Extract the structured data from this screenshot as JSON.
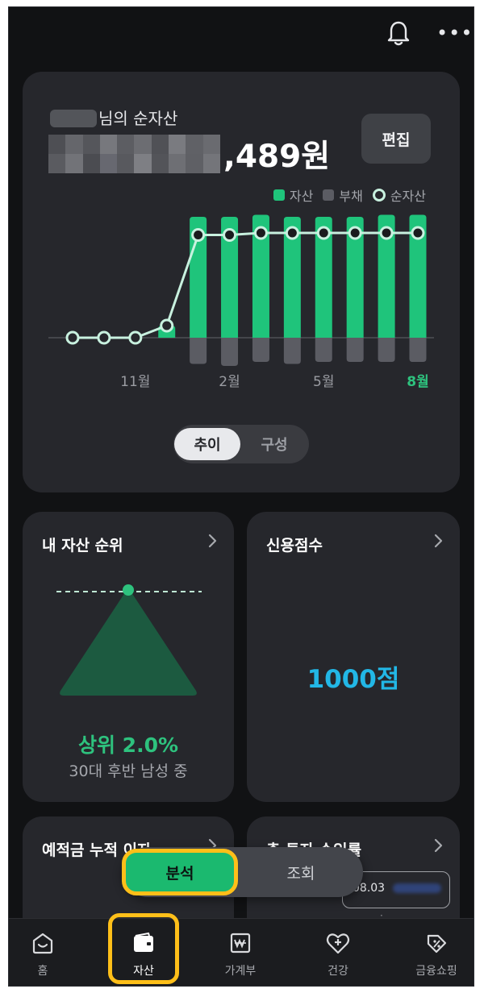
{
  "header": {
    "bell_icon": "bell-icon",
    "more_icon": "more-icon",
    "more_glyph": "•••"
  },
  "net_worth": {
    "owner_suffix": "님의 순자산",
    "amount_visible": ",489원",
    "edit_label": "편집"
  },
  "colors": {
    "asset": "#1fc47b",
    "debt": "#5b5c63",
    "net": "#c8f1df",
    "accent": "#2ec27e",
    "highlight": "#ffbf19",
    "credit": "#22b7e6"
  },
  "chart_data": {
    "type": "bar",
    "legend": [
      "자산",
      "부채",
      "순자산"
    ],
    "x_tick_labels": [
      "11월",
      "2월",
      "5월",
      "8월"
    ],
    "highlighted_tick": "8월",
    "series": [
      {
        "name": "자산",
        "values": [
          0,
          0,
          0,
          0.3,
          3.0,
          3.0,
          3.05,
          3.0,
          3.0,
          3.0,
          3.05,
          3.05
        ]
      },
      {
        "name": "부채",
        "values": [
          0,
          0,
          0,
          0,
          -0.65,
          -0.7,
          -0.6,
          -0.65,
          -0.6,
          -0.6,
          -0.6,
          -0.6
        ]
      },
      {
        "name": "순자산",
        "values": [
          0,
          0,
          0,
          0.3,
          2.55,
          2.55,
          2.6,
          2.6,
          2.6,
          2.6,
          2.6,
          2.6
        ]
      }
    ],
    "ylim": [
      -0.8,
      3.2
    ],
    "grid": false,
    "legend_position": "top-right"
  },
  "toggle": {
    "trend_label": "추이",
    "composition_label": "구성"
  },
  "rank_card": {
    "title": "내 자산 순위",
    "rank_text": "상위 2.0%",
    "rank_sub": "30대 후반 남성 중"
  },
  "credit_card": {
    "title": "신용점수",
    "score_text": "1000점"
  },
  "deposit_card": {
    "title": "예적금 누적 이자"
  },
  "invest_card": {
    "title": "총 투자 수익률",
    "date": "08.03"
  },
  "analysis_toggle": {
    "analysis_label": "분석",
    "lookup_label": "조회"
  },
  "bottom_nav": [
    {
      "label": "홈",
      "icon": "home-icon"
    },
    {
      "label": "자산",
      "icon": "wallet-icon"
    },
    {
      "label": "가계부",
      "icon": "ledger-icon"
    },
    {
      "label": "건강",
      "icon": "health-icon"
    },
    {
      "label": "금융쇼핑",
      "icon": "shopping-icon"
    }
  ]
}
